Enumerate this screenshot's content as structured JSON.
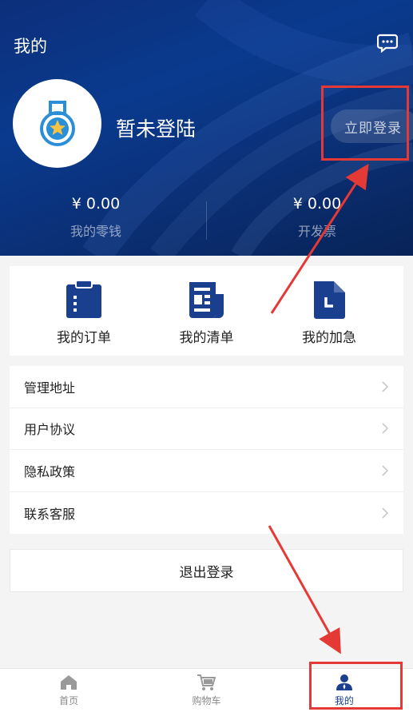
{
  "header": {
    "title": "我的",
    "chat_icon": "chat-bubble-icon",
    "avatar_icon": "medal-icon",
    "login_status": "暂未登陆",
    "login_button": "立即登录",
    "stats": [
      {
        "amount": "¥ 0.00",
        "label": "我的零钱"
      },
      {
        "amount": "¥ 0.00",
        "label": "开发票"
      }
    ]
  },
  "actions": [
    {
      "label": "我的订单",
      "icon": "clipboard-icon"
    },
    {
      "label": "我的清单",
      "icon": "document-list-icon"
    },
    {
      "label": "我的加急",
      "icon": "file-clock-icon"
    }
  ],
  "menu": [
    {
      "label": "管理地址"
    },
    {
      "label": "用户协议"
    },
    {
      "label": "隐私政策"
    },
    {
      "label": "联系客服"
    }
  ],
  "logout_label": "退出登录",
  "tabbar": [
    {
      "label": "首页",
      "icon": "home-icon",
      "active": false
    },
    {
      "label": "购物车",
      "icon": "cart-icon",
      "active": false
    },
    {
      "label": "我的",
      "icon": "user-icon",
      "active": true
    }
  ],
  "colors": {
    "header_bg": "#0a3a8e",
    "primary_icon": "#1a3f8f",
    "annotation": "#e53935"
  }
}
